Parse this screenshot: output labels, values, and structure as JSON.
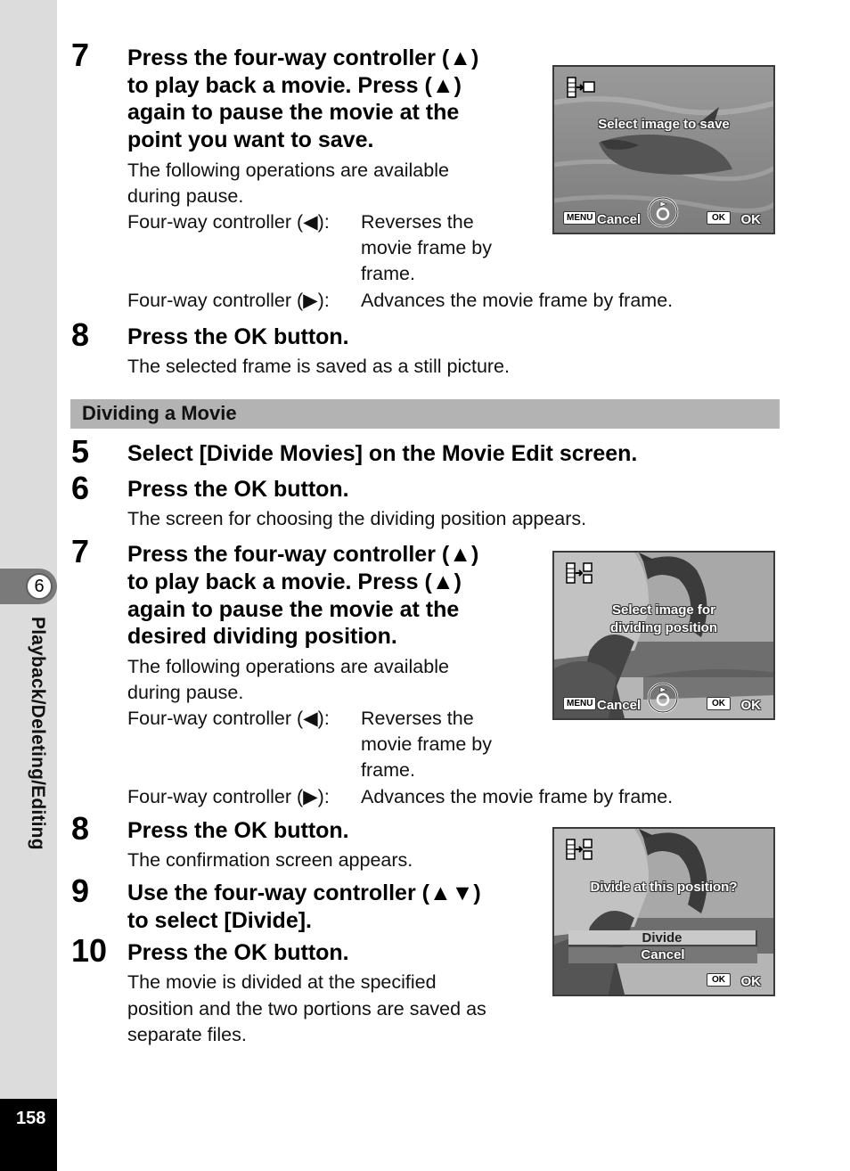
{
  "sidebar": {
    "chapter_number": "6",
    "chapter_title": "Playback/Deleting/Editing",
    "page_number": "158"
  },
  "save_section": {
    "step7": {
      "number": "7",
      "title_lines": [
        "Press the four-way controller (▲)",
        "to play back a movie. Press (▲)",
        "again to pause the movie at the",
        "point you want to save."
      ],
      "intro_lines": [
        "The following operations are available",
        "during pause."
      ],
      "op_left_label": "Four-way controller (◀):",
      "op_left_desc_lines": [
        "Reverses the",
        "movie frame by",
        "frame."
      ],
      "op_right_label": "Four-way controller (▶):",
      "op_right_desc": "Advances the movie frame by frame."
    },
    "step8": {
      "number": "8",
      "title": "Press the OK button.",
      "body": "The selected frame is saved as a still picture."
    },
    "screen": {
      "message": "Select image to save",
      "menu_key": "MENU",
      "cancel_label": "Cancel",
      "ok_key": "OK",
      "ok_label": "OK"
    }
  },
  "divide_section": {
    "heading": "Dividing a Movie",
    "step5": {
      "number": "5",
      "title": "Select [Divide Movies] on the Movie Edit screen."
    },
    "step6": {
      "number": "6",
      "title": "Press the OK button.",
      "body": "The screen for choosing the dividing position appears."
    },
    "step7": {
      "number": "7",
      "title_lines": [
        "Press the four-way controller (▲)",
        "to play back a movie. Press (▲)",
        "again to pause the movie at the",
        "desired dividing position."
      ],
      "intro_lines": [
        "The following operations are available",
        "during pause."
      ],
      "op_left_label": "Four-way controller (◀):",
      "op_left_desc_lines": [
        "Reverses the",
        "movie frame by",
        "frame."
      ],
      "op_right_label": "Four-way controller (▶):",
      "op_right_desc": "Advances the movie frame by frame."
    },
    "step8": {
      "number": "8",
      "title": "Press the OK button.",
      "body": "The confirmation screen appears."
    },
    "step9": {
      "number": "9",
      "title_lines": [
        "Use the four-way controller (▲▼)",
        "to select [Divide]."
      ]
    },
    "step10": {
      "number": "10",
      "title": "Press the OK button.",
      "body_lines": [
        "The movie is divided at the specified",
        "position and the two portions are saved as",
        "separate files."
      ]
    },
    "screen_select": {
      "message_lines": [
        "Select image for",
        "dividing position"
      ],
      "menu_key": "MENU",
      "cancel_label": "Cancel",
      "ok_key": "OK",
      "ok_label": "OK"
    },
    "screen_confirm": {
      "message": "Divide at this position?",
      "options": [
        "Divide",
        "Cancel"
      ],
      "selected_option": "Divide",
      "ok_key": "OK",
      "ok_label": "OK"
    }
  }
}
